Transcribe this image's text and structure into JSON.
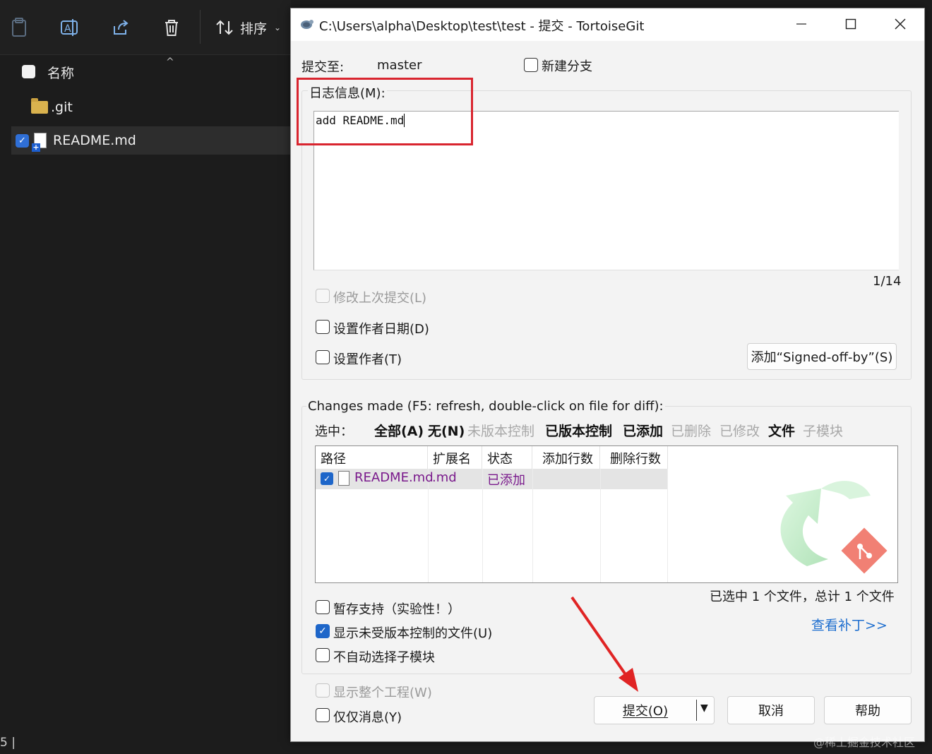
{
  "explorer": {
    "sort_label": "排序",
    "column_name": "名称",
    "files": [
      {
        "name": ".git"
      },
      {
        "name": "README.md"
      }
    ],
    "status_tail": "5 |"
  },
  "dialog": {
    "title": "C:\\Users\\alpha\\Desktop\\test\\test - 提交 - TortoiseGit",
    "commit_to_label": "提交至:",
    "branch": "master",
    "new_branch_label": "新建分支",
    "log_message_label": "日志信息(M):",
    "log_message_value": "add README.md",
    "counter": "1/14",
    "amend_label": "修改上次提交(L)",
    "set_author_date_label": "设置作者日期(D)",
    "set_author_label": "设置作者(T)",
    "signed_off_button": "添加“Signed-off-by”(S)",
    "changes_label": "Changes made (F5: refresh, double-click on file for diff):",
    "select_label": "选中：",
    "filters": [
      {
        "label": "全部(A)",
        "active": true
      },
      {
        "label": "无(N)",
        "active": true
      },
      {
        "label": "未版本控制",
        "active": false
      },
      {
        "label": "已版本控制",
        "active": true
      },
      {
        "label": "已添加",
        "active": true
      },
      {
        "label": "已删除",
        "active": false
      },
      {
        "label": "已修改",
        "active": false
      },
      {
        "label": "文件",
        "active": true
      },
      {
        "label": "子模块",
        "active": false
      }
    ],
    "columns": [
      "路径",
      "扩展名",
      "状态",
      "添加行数",
      "删除行数"
    ],
    "rows": [
      {
        "path": "README.md",
        "ext": ".md",
        "status": "已添加",
        "added": "",
        "deleted": "",
        "checked": true
      }
    ],
    "selection_summary": "已选中 1 个文件，总计 1 个文件",
    "stash_label": "暂存支持（实验性！）",
    "show_unversioned_label": "显示未受版本控制的文件(U)",
    "no_auto_submodule_label": "不自动选择子模块",
    "view_patch_link": "查看补丁>>",
    "show_whole_project_label": "显示整个工程(W)",
    "message_only_label": "仅仅消息(Y)",
    "commit_button": "提交(O)",
    "cancel_button": "取消",
    "help_button": "帮助"
  },
  "watermark": "@稀土掘金技术社区",
  "colors": {
    "accent": "#1e66c9",
    "annotation_red": "#d9252f",
    "added_status": "#7a1a8c",
    "link": "#1f6fcf"
  }
}
